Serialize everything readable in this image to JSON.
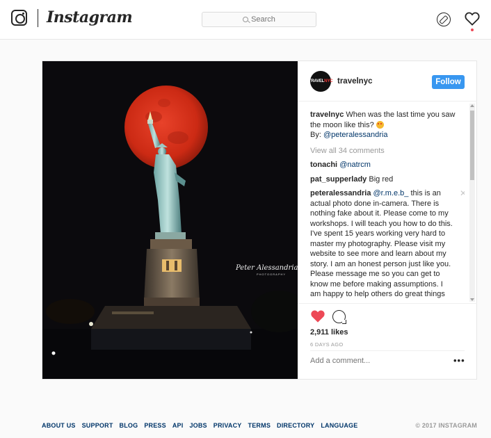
{
  "nav": {
    "brand": "Instagram",
    "search_placeholder": "Search"
  },
  "post": {
    "username": "travelnyc",
    "avatar_text_left": "TRAVEL",
    "avatar_text_right": "NYC",
    "follow_label": "Follow",
    "photo_signature": "Peter Alessandria",
    "photo_signature_sub": "PHOTOGRAPHY",
    "caption": {
      "user": "travelnyc",
      "text": "When was the last time you saw the moon like this?",
      "by_label": "By:",
      "by_handle": "@peteralessandria"
    },
    "view_all": "View all 34 comments",
    "comments": [
      {
        "user": "tonachi",
        "mention": "@natrcm",
        "text": ""
      },
      {
        "user": "pat_supperlady",
        "mention": "",
        "text": "Big red"
      },
      {
        "user": "peteralessandria",
        "mention": "@r.m.e.b_",
        "text": "this is an actual photo done in-camera. There is nothing fake about it. Please come to my workshops. I will teach you how to do this. I've spent 15 years working very hard to master my photography. Please visit my website to see more and learn about my story. I am an honest person just like you. Please message me so you can get to know me before making assumptions. I am happy to help others do great things with their photography too! Thank you!"
      }
    ],
    "likes": "2,911 likes",
    "timestamp": "6 DAYS AGO",
    "add_comment_placeholder": "Add a comment...",
    "more_label": "•••",
    "close_glyph": "✕"
  },
  "footer": {
    "links": [
      "ABOUT US",
      "SUPPORT",
      "BLOG",
      "PRESS",
      "API",
      "JOBS",
      "PRIVACY",
      "TERMS",
      "DIRECTORY",
      "LANGUAGE"
    ],
    "copyright": "© 2017 INSTAGRAM"
  },
  "colors": {
    "accent": "#3897f0",
    "like_red": "#ed4956",
    "moon": "#d9321c"
  },
  "icons": {
    "brand_glyph": "instagram-glyph-icon",
    "search": "search-icon",
    "explore": "compass-icon",
    "activity": "heart-icon",
    "like": "heart-filled-icon",
    "comment": "comment-bubble-icon"
  }
}
